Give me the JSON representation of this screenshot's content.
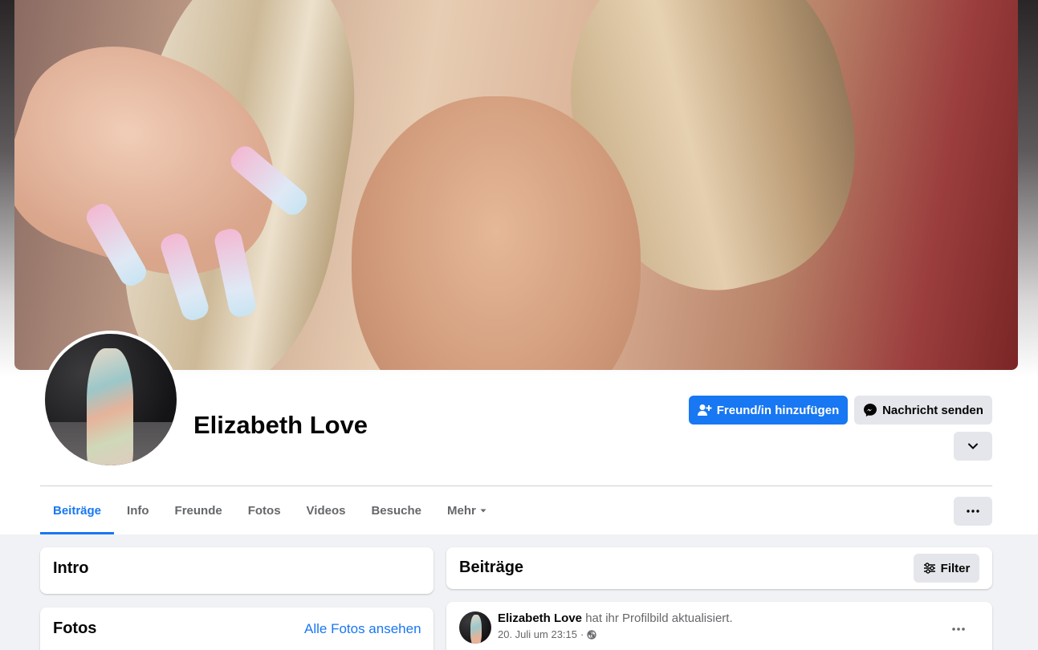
{
  "profile": {
    "name": "Elizabeth Love"
  },
  "actions": {
    "add_friend": "Freund/in hinzufügen",
    "send_message": "Nachricht senden"
  },
  "tabs": [
    {
      "label": "Beiträge",
      "active": true
    },
    {
      "label": "Info",
      "active": false
    },
    {
      "label": "Freunde",
      "active": false
    },
    {
      "label": "Fotos",
      "active": false
    },
    {
      "label": "Videos",
      "active": false
    },
    {
      "label": "Besuche",
      "active": false
    },
    {
      "label": "Mehr",
      "active": false
    }
  ],
  "intro": {
    "title": "Intro"
  },
  "photos": {
    "title": "Fotos",
    "link": "Alle Fotos ansehen"
  },
  "posts": {
    "title": "Beiträge",
    "filter_label": "Filter"
  },
  "post": {
    "author": "Elizabeth Love",
    "action": " hat ihr Profilbild aktualisiert.",
    "time": "20. Juli um 23:15",
    "separator": "·"
  },
  "colors": {
    "accent": "#1877f2",
    "secondary_button": "#e4e6eb",
    "page_bg": "#f0f2f5"
  },
  "icons": [
    "add-friend-icon",
    "messenger-icon",
    "chevron-down-icon",
    "more-dots-icon",
    "filter-icon",
    "globe-icon",
    "caret-down-icon"
  ]
}
